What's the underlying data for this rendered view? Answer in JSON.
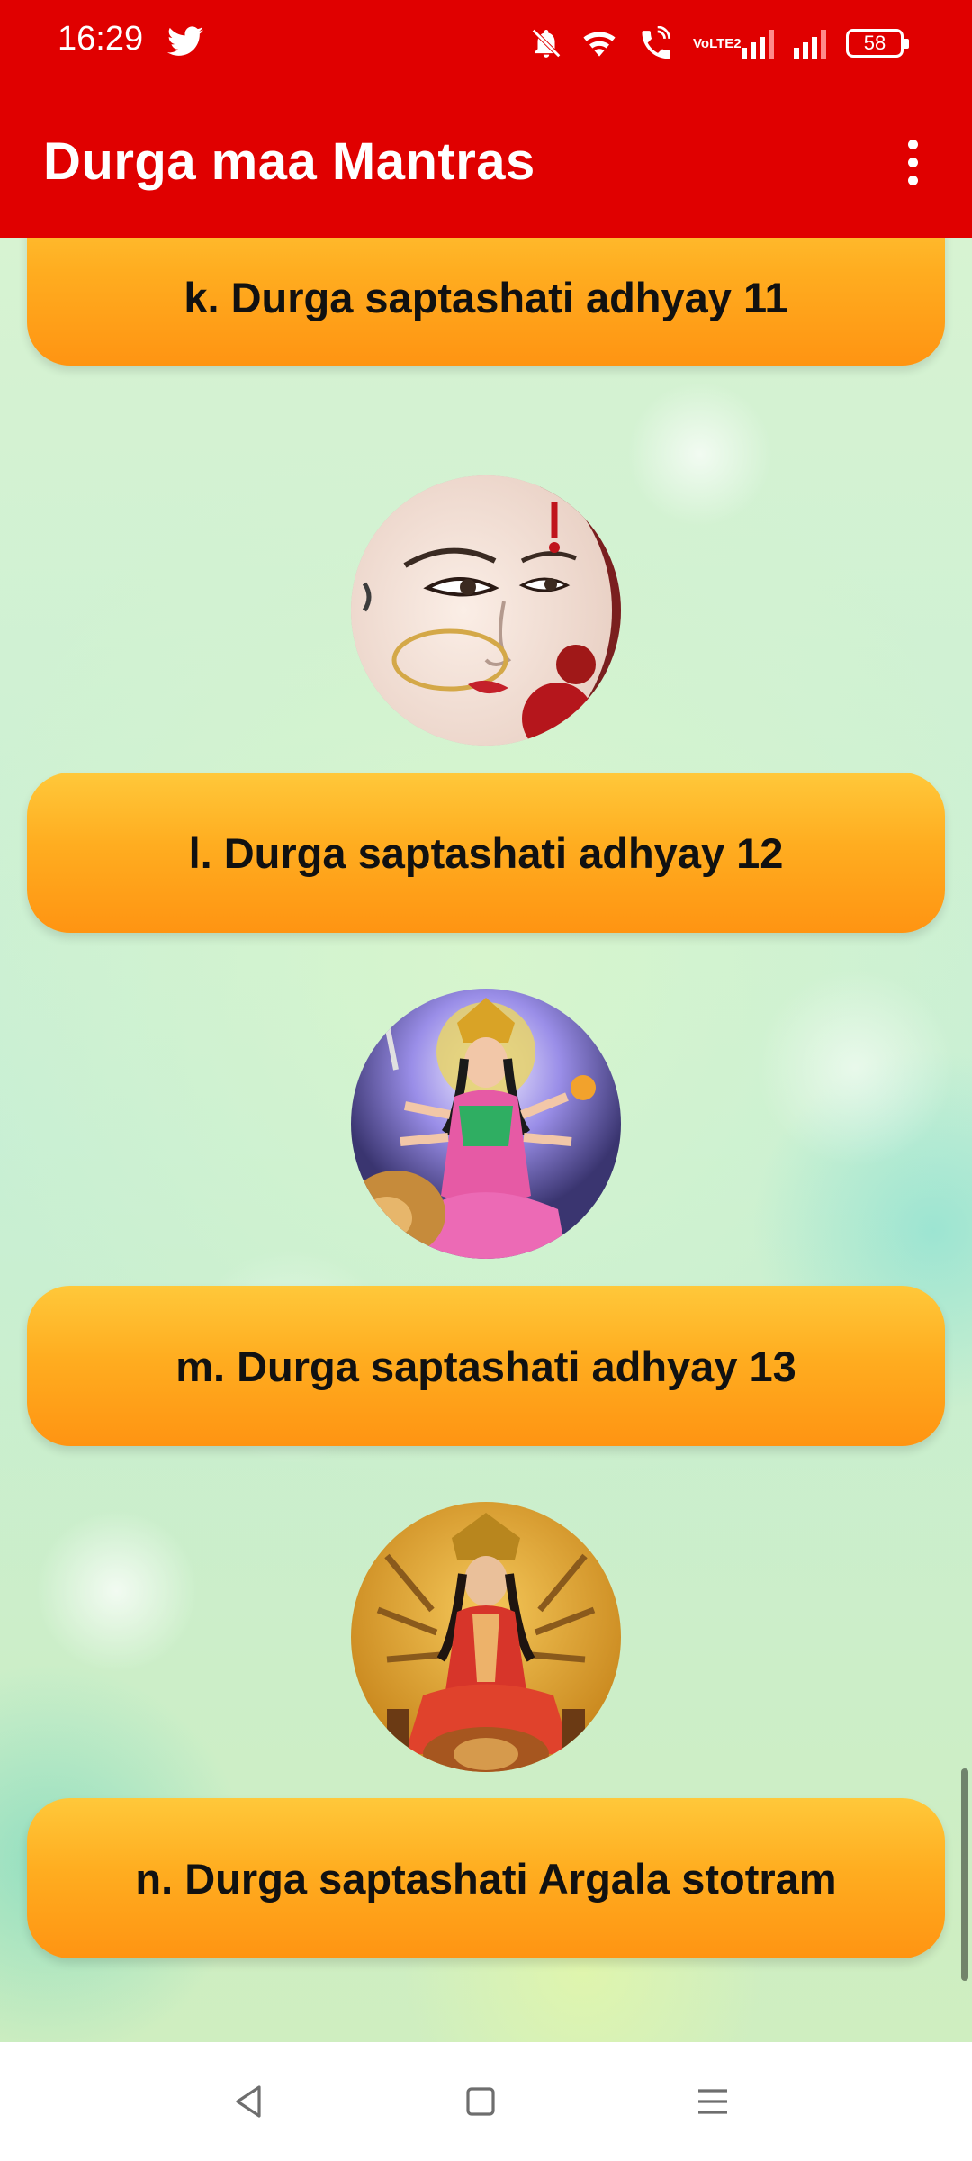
{
  "status_bar": {
    "time": "16:29",
    "volte_top": "Vo",
    "volte_bottom": "LTE2",
    "battery": "58",
    "icons": [
      "twitter-icon",
      "mute-icon",
      "wifi-icon",
      "wifi-call-icon",
      "volte-icon",
      "signal-icon",
      "signal-icon",
      "battery-icon"
    ]
  },
  "app_bar": {
    "title": "Durga maa Mantras",
    "menu_icon": "more-vert-icon"
  },
  "list": {
    "items": [
      {
        "label": "k. Durga saptashati adhyay 11"
      },
      {
        "label": "l. Durga saptashati adhyay 12"
      },
      {
        "label": "m. Durga saptashati adhyay 13"
      },
      {
        "label": "n. Durga saptashati Argala stotram"
      }
    ],
    "images": [
      "durga-face-image",
      "durga-lion-image",
      "durga-throne-image"
    ]
  },
  "nav_bar": {
    "icons": [
      "back-icon",
      "home-icon",
      "recents-icon"
    ]
  },
  "colors": {
    "app_bar": "#e00000",
    "button_top": "#ffc83a",
    "button_bottom": "#ff9412",
    "background": "#d7f3d2"
  }
}
